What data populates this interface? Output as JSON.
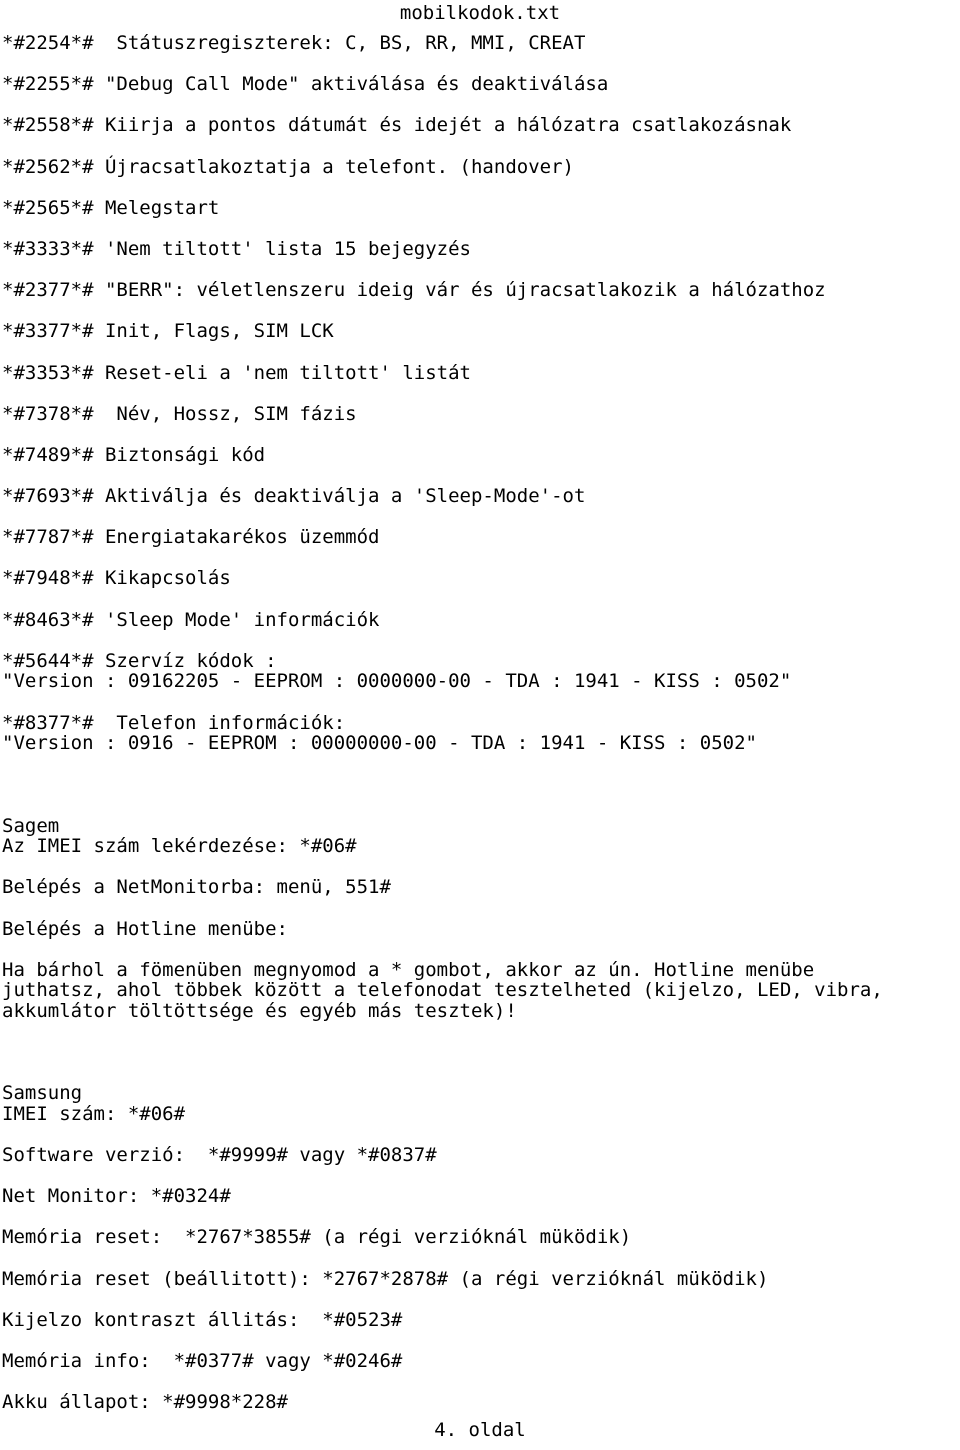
{
  "document": {
    "title": "mobilkodok.txt",
    "footer": "4. oldal"
  },
  "body_lines": [
    {
      "id": "l1",
      "text": "*#2254*#  Státuszregiszterek: C, BS, RR, MMI, CREAT"
    },
    {
      "id": "s1",
      "text": ""
    },
    {
      "id": "l2",
      "text": "*#2255*# \"Debug Call Mode\" aktiválása és deaktiválása"
    },
    {
      "id": "s2",
      "text": ""
    },
    {
      "id": "l3",
      "text": "*#2558*# Kiirja a pontos dátumát és idejét a hálózatra csatlakozásnak"
    },
    {
      "id": "s3",
      "text": ""
    },
    {
      "id": "l4",
      "text": "*#2562*# Újracsatlakoztatja a telefont. (handover)"
    },
    {
      "id": "s4",
      "text": ""
    },
    {
      "id": "l5",
      "text": "*#2565*# Melegstart"
    },
    {
      "id": "s5",
      "text": ""
    },
    {
      "id": "l6",
      "text": "*#3333*# 'Nem tiltott' lista 15 bejegyzés"
    },
    {
      "id": "s6",
      "text": ""
    },
    {
      "id": "l7",
      "text": "*#2377*# \"BERR\": véletlenszeru ideig vár és újracsatlakozik a hálózathoz"
    },
    {
      "id": "s7",
      "text": ""
    },
    {
      "id": "l8",
      "text": "*#3377*# Init, Flags, SIM LCK"
    },
    {
      "id": "s8",
      "text": ""
    },
    {
      "id": "l9",
      "text": "*#3353*# Reset-eli a 'nem tiltott' listát"
    },
    {
      "id": "s9",
      "text": ""
    },
    {
      "id": "l10",
      "text": "*#7378*#  Név, Hossz, SIM fázis"
    },
    {
      "id": "s10",
      "text": ""
    },
    {
      "id": "l11",
      "text": "*#7489*# Biztonsági kód"
    },
    {
      "id": "s11",
      "text": ""
    },
    {
      "id": "l12",
      "text": "*#7693*# Aktiválja és deaktiválja a 'Sleep-Mode'-ot"
    },
    {
      "id": "s12",
      "text": ""
    },
    {
      "id": "l13",
      "text": "*#7787*# Energiatakarékos üzemmód"
    },
    {
      "id": "s13",
      "text": ""
    },
    {
      "id": "l14",
      "text": "*#7948*# Kikapcsolás"
    },
    {
      "id": "s14",
      "text": ""
    },
    {
      "id": "l15",
      "text": "*#8463*# 'Sleep Mode' információk"
    },
    {
      "id": "s15",
      "text": ""
    },
    {
      "id": "l16",
      "text": "*#5644*# Szervíz kódok :"
    },
    {
      "id": "l17",
      "text": "\"Version : 09162205 - EEPROM : 0000000-00 - TDA : 1941 - KISS : 0502\""
    },
    {
      "id": "s16",
      "text": ""
    },
    {
      "id": "l18",
      "text": "*#8377*#  Telefon információk:"
    },
    {
      "id": "l19",
      "text": "\"Version : 0916 - EEPROM : 00000000-00 - TDA : 1941 - KISS : 0502\""
    },
    {
      "id": "s17",
      "text": ""
    },
    {
      "id": "s18",
      "text": ""
    },
    {
      "id": "s19",
      "text": ""
    },
    {
      "id": "l20",
      "text": "Sagem"
    },
    {
      "id": "l21",
      "text": "Az IMEI szám lekérdezése: *#06#"
    },
    {
      "id": "s20",
      "text": ""
    },
    {
      "id": "l22",
      "text": "Belépés a NetMonitorba: menü, 551#"
    },
    {
      "id": "s21",
      "text": ""
    },
    {
      "id": "l23",
      "text": "Belépés a Hotline menübe:"
    },
    {
      "id": "s22",
      "text": ""
    },
    {
      "id": "l24",
      "text": "Ha bárhol a fömenüben megnyomod a * gombot, akkor az ún. Hotline menübe"
    },
    {
      "id": "l25",
      "text": "juthatsz, ahol többek között a telefonodat tesztelheted (kijelzo, LED, vibra,"
    },
    {
      "id": "l26",
      "text": "akkumlátor töltöttsége és egyéb más tesztek)!"
    },
    {
      "id": "s23",
      "text": ""
    },
    {
      "id": "s24",
      "text": ""
    },
    {
      "id": "s25",
      "text": ""
    },
    {
      "id": "l27",
      "text": "Samsung"
    },
    {
      "id": "l28",
      "text": "IMEI szám: *#06#"
    },
    {
      "id": "s26",
      "text": ""
    },
    {
      "id": "l29",
      "text": "Software verzió:  *#9999# vagy *#0837#"
    },
    {
      "id": "s27",
      "text": ""
    },
    {
      "id": "l30",
      "text": "Net Monitor: *#0324#"
    },
    {
      "id": "s28",
      "text": ""
    },
    {
      "id": "l31",
      "text": "Memória reset:  *2767*3855# (a régi verzióknál müködik)"
    },
    {
      "id": "s29",
      "text": ""
    },
    {
      "id": "l32",
      "text": "Memória reset (beállitott): *2767*2878# (a régi verzióknál müködik)"
    },
    {
      "id": "s30",
      "text": ""
    },
    {
      "id": "l33",
      "text": "Kijelzo kontraszt állitás:  *#0523#"
    },
    {
      "id": "s31",
      "text": ""
    },
    {
      "id": "l34",
      "text": "Memória info:  *#0377# vagy *#0246#"
    },
    {
      "id": "s32",
      "text": ""
    },
    {
      "id": "l35",
      "text": "Akku állapot: *#9998*228#"
    }
  ],
  "colors": {
    "page_background": "#ffffff",
    "text": "#000000"
  }
}
